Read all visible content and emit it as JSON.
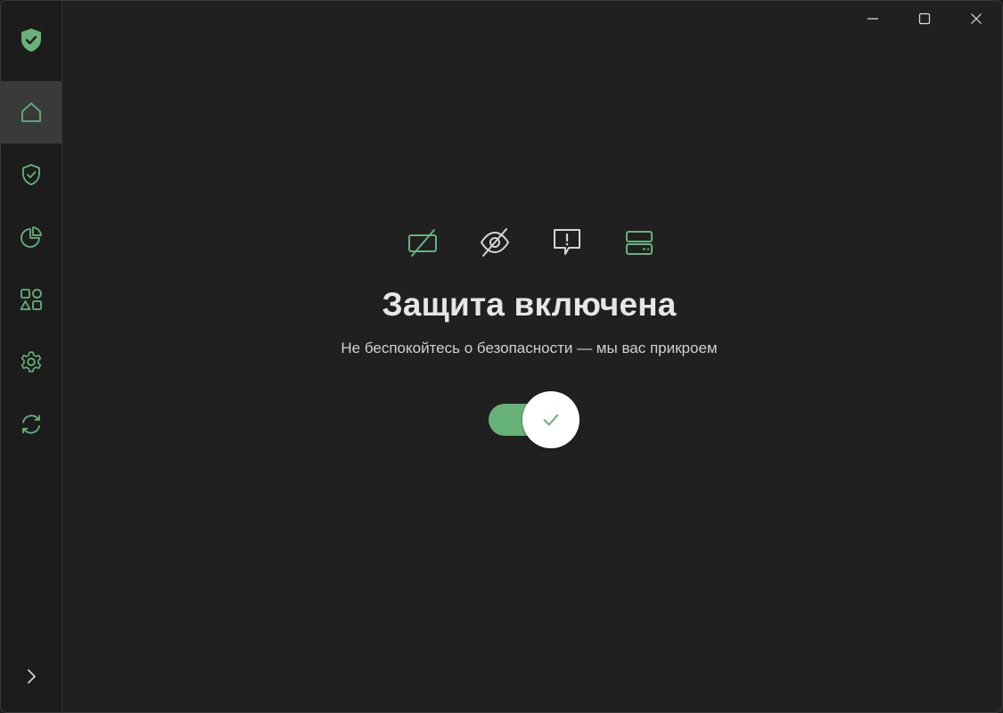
{
  "app": {
    "brand_color": "#67b279",
    "logo_icon": "shield-check-icon"
  },
  "sidebar": {
    "items": [
      {
        "name": "home",
        "icon": "home-icon",
        "active": true
      },
      {
        "name": "protection",
        "icon": "shield-check-icon",
        "active": false
      },
      {
        "name": "statistics",
        "icon": "pie-chart-icon",
        "active": false
      },
      {
        "name": "apps",
        "icon": "apps-grid-icon",
        "active": false
      },
      {
        "name": "settings",
        "icon": "gear-icon",
        "active": false
      },
      {
        "name": "updates",
        "icon": "refresh-icon",
        "active": false
      }
    ],
    "expand_icon": "chevron-right-icon"
  },
  "window_controls": [
    "minimize-icon",
    "maximize-icon",
    "close-icon"
  ],
  "main": {
    "feature_icons": [
      "ad-block-icon",
      "tracking-protection-icon",
      "annoyance-icon",
      "dns-server-icon"
    ],
    "title": "Защита включена",
    "subtitle": "Не беспокойтесь о безопасности — мы вас прикроем",
    "toggle": {
      "state": "on",
      "icon": "check-icon"
    }
  }
}
